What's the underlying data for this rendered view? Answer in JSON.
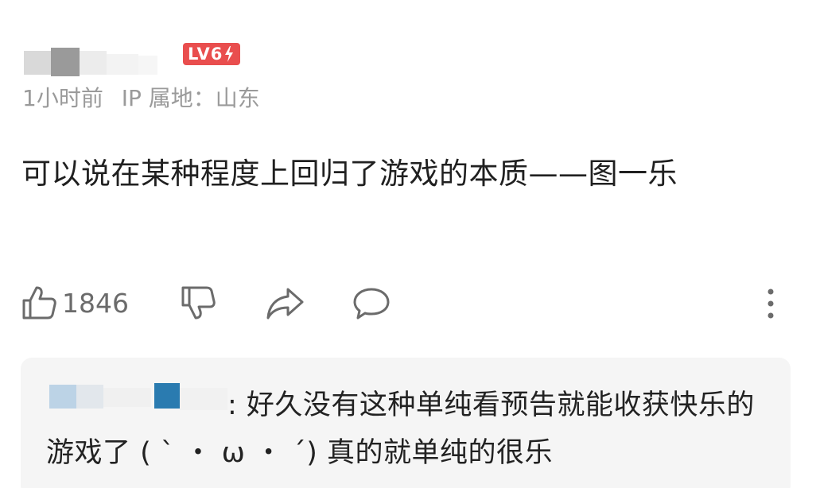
{
  "user": {
    "level_badge": "LV6"
  },
  "meta": {
    "time": "1小时前",
    "ip_location": "IP 属地：山东"
  },
  "comment": {
    "text": "可以说在某种程度上回归了游戏的本质——图一乐"
  },
  "actions": {
    "like_count": "1846"
  },
  "reply": {
    "text": ": 好久没有这种单纯看预告就能收获快乐的游戏了 ( ` ・ ω ・ ´) 真的就单纯的很乐"
  },
  "icons": {
    "like": "thumbs-up-icon",
    "dislike": "thumbs-down-icon",
    "share": "share-arrow-icon",
    "reply": "comment-bubble-icon",
    "more": "more-vertical-icon",
    "badge_bolt": "bolt-icon"
  },
  "colors": {
    "badge_bg": "#e94e4e",
    "meta_text": "#9a9a9a",
    "body_text": "#202020",
    "icon": "#6b6b6b",
    "reply_bg": "#f5f5f5"
  }
}
